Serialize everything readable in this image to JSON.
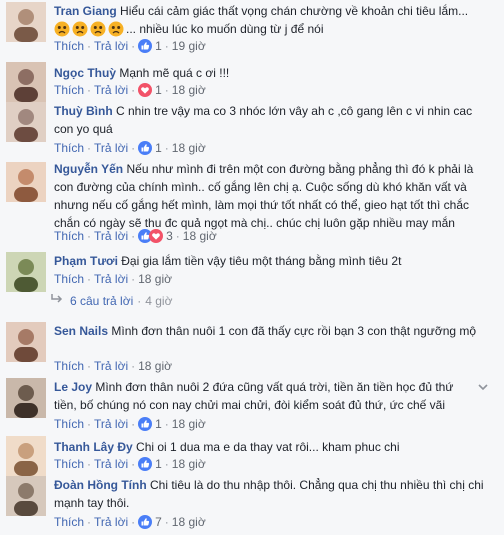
{
  "comments": [
    {
      "name": "Tran Giang",
      "text": " Hiểu cái cảm giác thất vọng chán chường về khoản chi tiêu lắm...",
      "text2": "... nhiều lúc ko muốn dùng từ j để nói",
      "like": "Thích",
      "reply": "Trả lời",
      "count": "1",
      "time": "19 giờ",
      "reactions": [
        "like-icon"
      ],
      "emojis": [
        "sad-face",
        "sad-face",
        "sad-face",
        "sad-face"
      ],
      "avatar_color": "#b08f7a"
    },
    {
      "name": "Ngọc Thuỳ",
      "text": " Mạnh mẽ quá c ơi !!!",
      "like": "Thích",
      "reply": "Trả lời",
      "count": "1",
      "time": "18 giờ",
      "reactions": [
        "love-icon"
      ],
      "avatar_color": "#8d6e63"
    },
    {
      "name": "Thuỳ Bình",
      "text": " C nhin tre vậy ma co 3 nhóc lớn vây ah c ,cô gang lên c vi nhin cac con yo quá",
      "like": "Thích",
      "reply": "Trả lời",
      "count": "1",
      "time": "18 giờ",
      "reactions": [
        "like-icon"
      ],
      "avatar_color": "#a1887f"
    },
    {
      "name": "Nguyễn Yến",
      "text": " Nếu như mình đi trên một con đường bằng phẳng thì đó k phải là con đường của chính mình.. cố gắng lên chị ạ. Cuộc sống dù khó khăn vất và nhưng nếu cố gắng hết mình, làm mọi thứ tốt nhất có thể, gieo hạt tốt thì chắc chắn có ngày sẽ thu đc quả ngọt mà chị.. chúc chị luôn gặp nhiều may mắn",
      "like": "Thích",
      "reply": "Trả lời",
      "count": "3",
      "time": "18 giờ",
      "reactions": [
        "like-icon",
        "love-icon"
      ],
      "avatar_color": "#c48b6c"
    },
    {
      "name": "Phạm Tươi",
      "text": " Đại gia lắm tiền vậy tiêu một tháng bằng mình tiêu 2t",
      "like": "Thích",
      "reply": "Trả lời",
      "count": "",
      "time": "18 giờ",
      "reactions": [],
      "avatar_color": "#7b8a57"
    }
  ],
  "replies_summary": {
    "label": "6 câu trả lời",
    "time": "4 giờ"
  },
  "comments2": [
    {
      "name": "Sen Nails",
      "text": " Mình đơn thân nuôi 1 con đã thấy cực rồi bạn 3 con thật ngưỡng mộ",
      "like": "Thích",
      "reply": "Trả lời",
      "count": "",
      "time": "18 giờ",
      "reactions": [],
      "avatar_color": "#a67a66"
    },
    {
      "name": "Le Joy",
      "text": " Mình đơn thân nuôi 2 đứa cũng vất quá trời, tiền ăn tiền học đủ thứ tiền, bố chúng nó con nay chửi mai chửi, đòi kiểm soát đủ thứ, ức chế vãi",
      "like": "Thích",
      "reply": "Trả lời",
      "count": "1",
      "time": "18 giờ",
      "reactions": [
        "like-icon"
      ],
      "avatar_color": "#6d5c4e"
    },
    {
      "name": "Thanh Lây Đy",
      "text": " Chi oi 1 dua ma e da thay vat rôi... kham phuc chi",
      "like": "Thích",
      "reply": "Trả lời",
      "count": "1",
      "time": "18 giờ",
      "reactions": [
        "like-icon"
      ],
      "avatar_color": "#c9a07e"
    },
    {
      "name": "Đoàn Hồng Tính",
      "text": " Chi tiêu là do thu nhập thôi. Chẳng qua chị thu nhiều thì chị chi mạnh tay thôi.",
      "like": "Thích",
      "reply": "Trả lời",
      "count": "7",
      "time": "18 giờ",
      "reactions": [
        "like-icon"
      ],
      "avatar_color": "#8c7a6b"
    }
  ],
  "colors": {
    "link": "#365899",
    "action": "#4267b2",
    "meta": "#90949c",
    "like_blue": "#4a7ef7",
    "love_red": "#f25268"
  }
}
